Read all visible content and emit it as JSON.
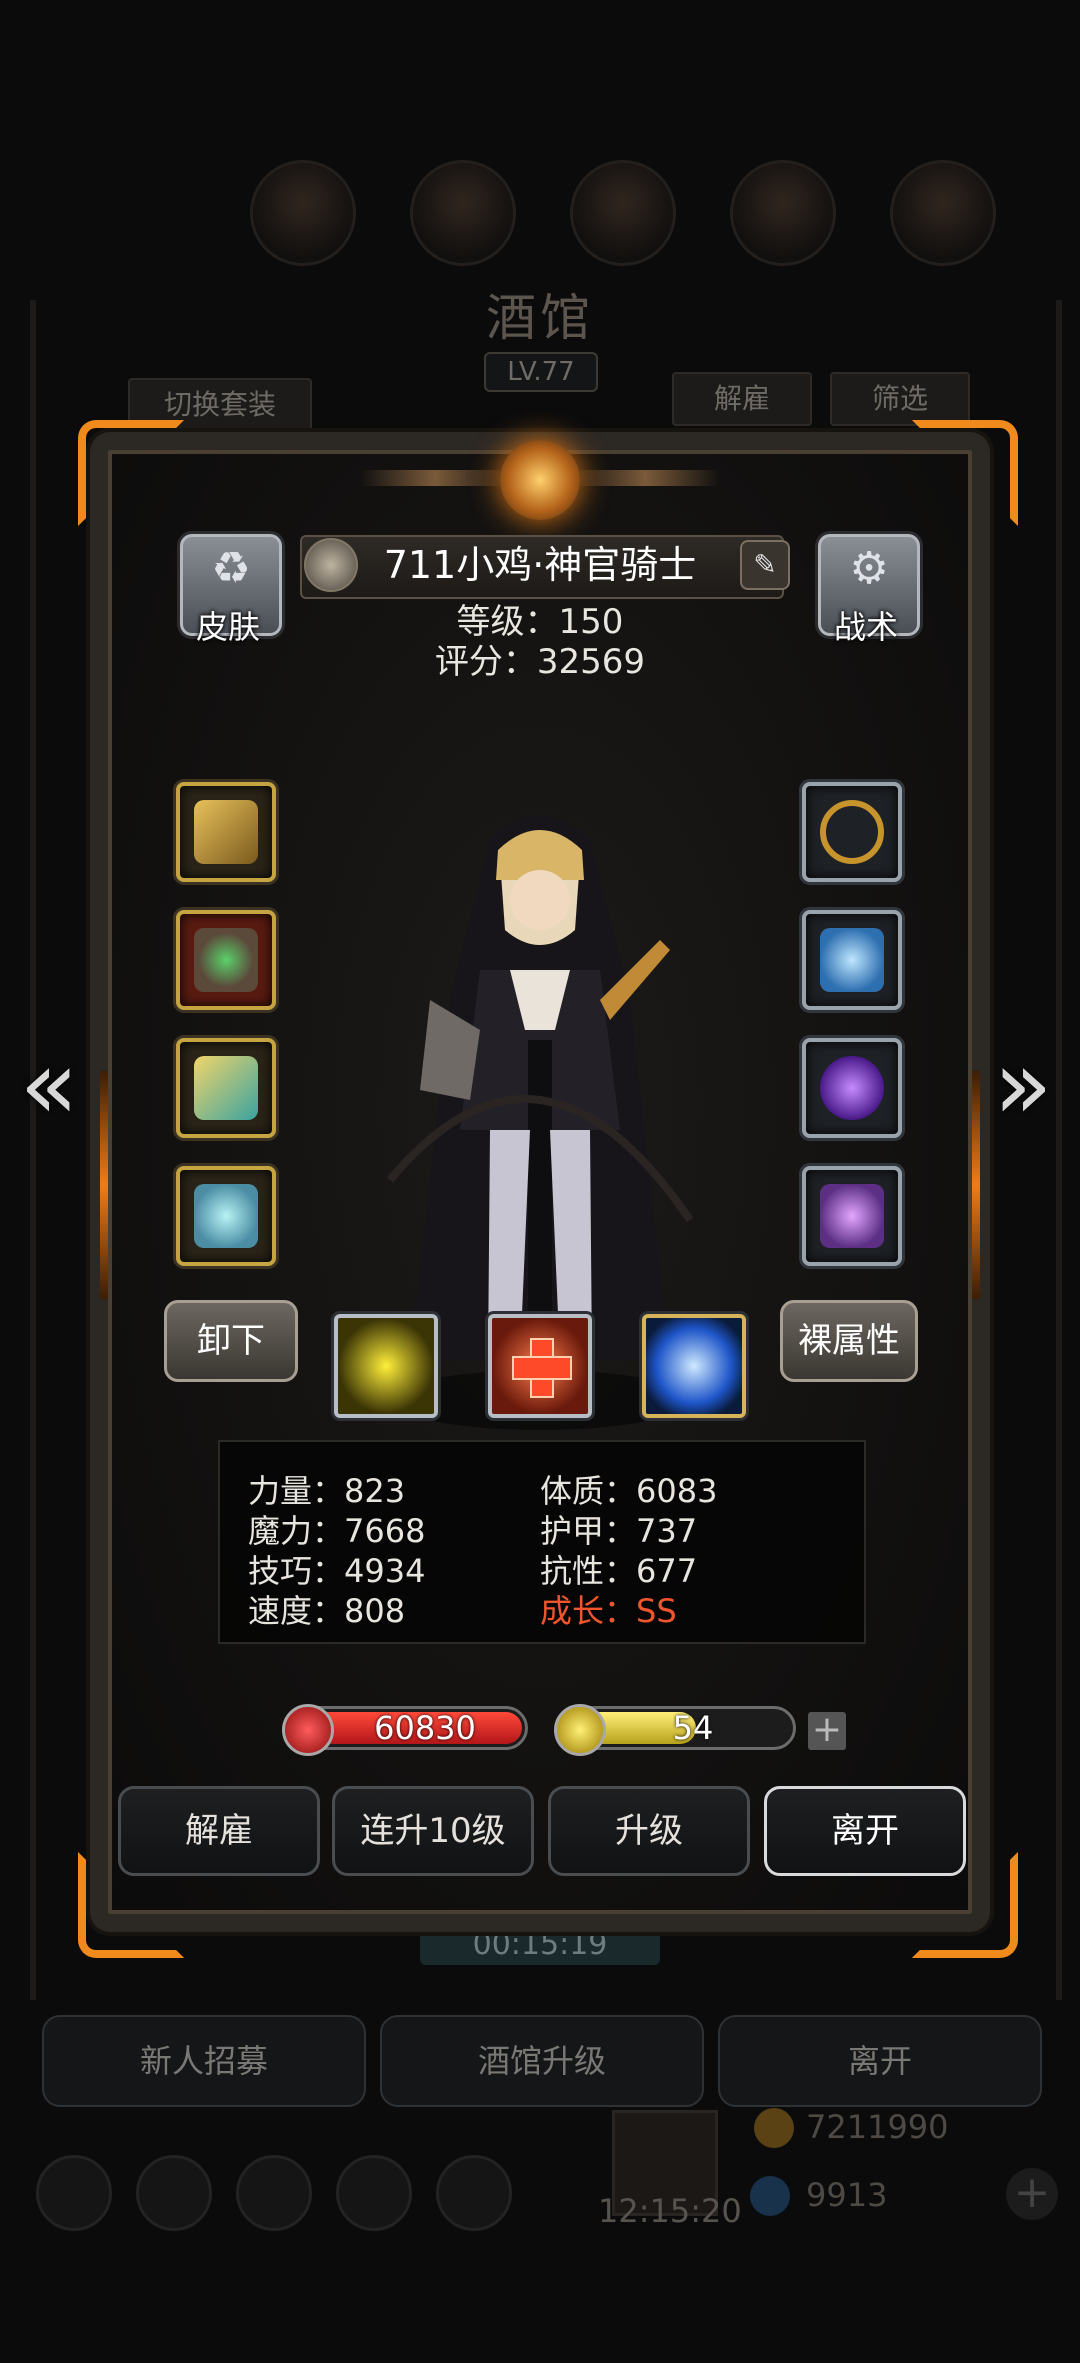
{
  "background": {
    "title": "酒馆",
    "level": "LV.77",
    "tabs": {
      "switch_outfit": "切换套装",
      "dismiss": "解雇",
      "filter": "筛选"
    },
    "timer": "00:15:19",
    "buttons": {
      "recruit": "新人招募",
      "upgrade": "酒馆升级",
      "leave": "离开"
    },
    "gift_timer": "12:15:20",
    "resource_gold": "7211990",
    "resource_gem": "9913"
  },
  "hero": {
    "name": "711小鸡·神官骑士",
    "level_text": "等级：150",
    "score_text": "评分：32569"
  },
  "side_buttons": {
    "skin": "皮肤",
    "tactics": "战术"
  },
  "actions": {
    "unequip": "卸下",
    "base_attr": "裸属性"
  },
  "equipment": {
    "left": [
      "staff-icon",
      "amulet-icon",
      "gauntlet-icon",
      "ring-icon"
    ],
    "right": [
      "halo-icon",
      "crystal-icon",
      "orb-icon",
      "relic-icon"
    ]
  },
  "skills": [
    "fist-skill-icon",
    "heal-cross-skill-icon",
    "eye-skill-icon"
  ],
  "stats": {
    "str": "力量：823",
    "con": "体质：6083",
    "mag": "魔力：7668",
    "armor": "护甲：737",
    "skill": "技巧：4934",
    "res": "抗性：677",
    "speed": "速度：808",
    "growth": "成长：SS"
  },
  "bars": {
    "hp": "60830",
    "energy": "54",
    "hp_fill": 1.0,
    "energy_fill": 0.58
  },
  "bottom_actions": {
    "dismiss": "解雇",
    "level10": "连升10级",
    "levelup": "升级",
    "leave": "离开"
  },
  "colors": {
    "accent_orange": "#f08a1c",
    "hp_red": "#d42a2a",
    "energy_yellow": "#e8d23a",
    "growth_red": "#f0552d"
  }
}
